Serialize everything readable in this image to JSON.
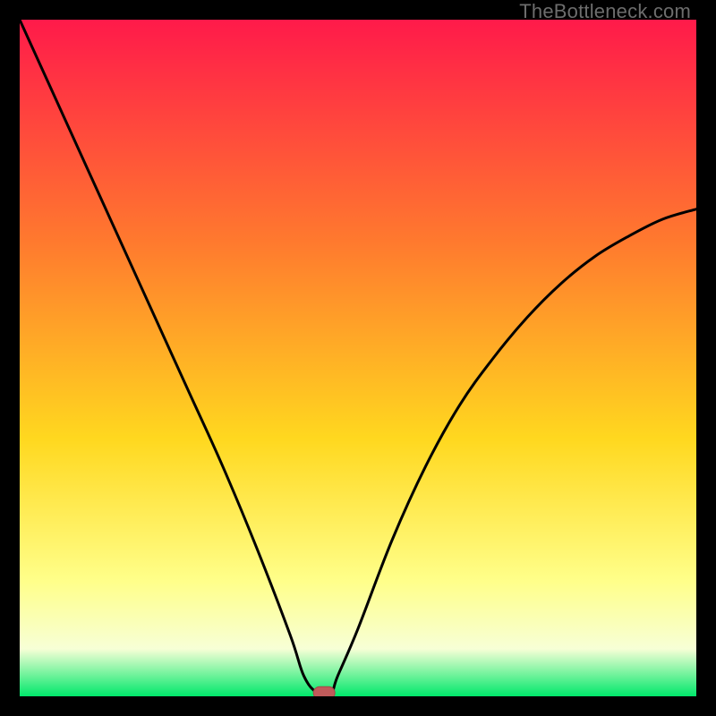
{
  "watermark": "TheBottleneck.com",
  "colors": {
    "bg": "#000000",
    "gradient_top": "#ff1a4a",
    "gradient_mid_upper": "#ff7a2e",
    "gradient_mid": "#ffd81f",
    "gradient_mid_lower": "#ffff8a",
    "gradient_lower": "#f7ffd6",
    "gradient_bottom": "#00e86b",
    "curve": "#000000",
    "marker_fill": "#c05a5a",
    "marker_stroke": "#a64646"
  },
  "chart_data": {
    "type": "line",
    "title": "",
    "xlabel": "",
    "ylabel": "",
    "xlim": [
      0,
      100
    ],
    "ylim": [
      0,
      100
    ],
    "x": [
      0,
      5,
      10,
      15,
      20,
      25,
      30,
      35,
      40,
      42,
      44,
      46,
      47,
      50,
      55,
      60,
      65,
      70,
      75,
      80,
      85,
      90,
      95,
      100
    ],
    "values": [
      100,
      89,
      78,
      67,
      56,
      45,
      34,
      22,
      9,
      3,
      0.5,
      0.5,
      3,
      10,
      23,
      34,
      43,
      50,
      56,
      61,
      65,
      68,
      70.5,
      72
    ],
    "marker": {
      "x": 45,
      "y": 0.5
    },
    "gradient_stops": [
      {
        "offset": 0,
        "key": "gradient_top"
      },
      {
        "offset": 33,
        "key": "gradient_mid_upper"
      },
      {
        "offset": 62,
        "key": "gradient_mid"
      },
      {
        "offset": 83,
        "key": "gradient_mid_lower"
      },
      {
        "offset": 93,
        "key": "gradient_lower"
      },
      {
        "offset": 100,
        "key": "gradient_bottom"
      }
    ]
  }
}
